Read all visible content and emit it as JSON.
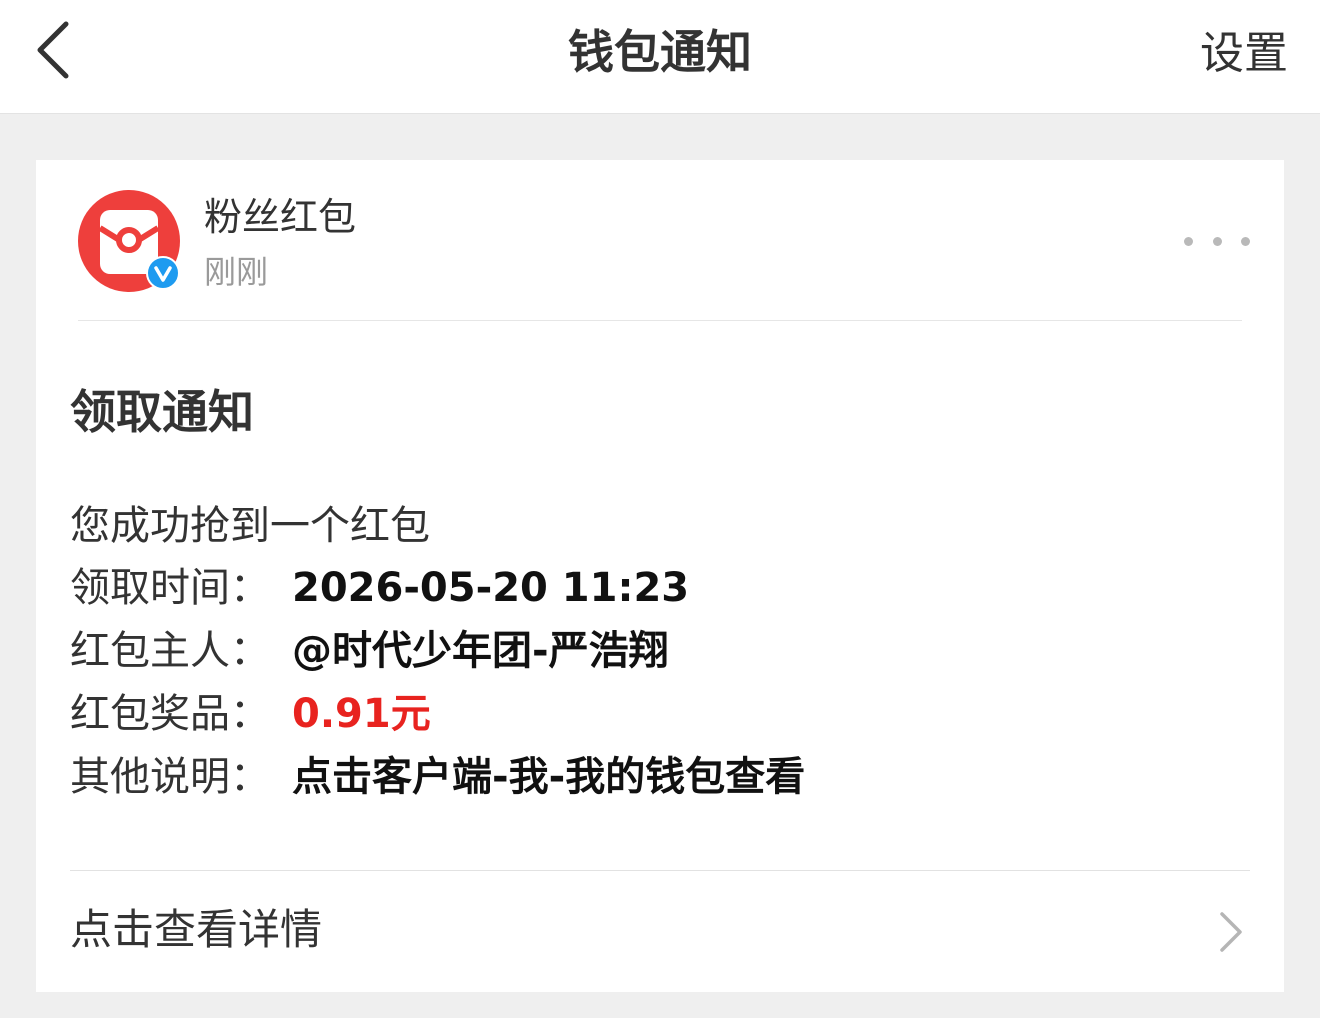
{
  "nav": {
    "title": "钱包通知",
    "settings_label": "设置",
    "back_icon": "chevron-left-icon"
  },
  "account": {
    "name": "粉丝红包",
    "time": "刚刚",
    "avatar_icon": "red-envelope-icon",
    "verified_icon": "verified-badge-icon",
    "more_icon": "more-horizontal-icon"
  },
  "notice": {
    "title": "领取通知",
    "intro": "您成功抢到一个红包",
    "rows": [
      {
        "label": "领取时间：",
        "value": "2026-05-20 11:23"
      },
      {
        "label": "红包主人：",
        "value": "@时代少年团-严浩翔"
      },
      {
        "label": "红包奖品：",
        "value": "0.91元"
      },
      {
        "label": "其他说明：",
        "value": "点击客户端-我-我的钱包查看"
      }
    ]
  },
  "footer": {
    "details_label": "点击查看详情",
    "chevron_icon": "chevron-right-icon"
  },
  "colors": {
    "accent_red": "#e8231f",
    "avatar_red": "#ee3f3c",
    "verified_blue": "#1e9bf0",
    "background": "#efefef",
    "card": "#ffffff"
  }
}
